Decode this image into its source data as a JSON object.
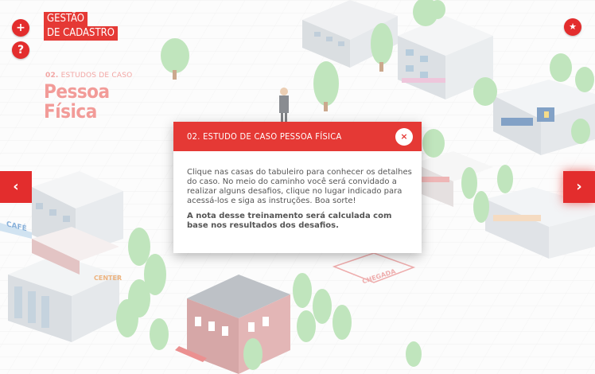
{
  "brand": {
    "line1": "GESTÃO",
    "line2": "DE CADASTRO"
  },
  "buttons": {
    "plus": "+",
    "help": "?",
    "star": "★",
    "prev": "‹",
    "next": "›"
  },
  "section": {
    "number": "02.",
    "label": "ESTUDOS DE CASO",
    "title1": "Pessoa",
    "title2": "Física"
  },
  "modal": {
    "title": "02. ESTUDO DE CASO PESSOA FÍSICA",
    "close": "×",
    "paragraph1": "Clique nas casas do tabuleiro para conhecer os detalhes do caso. No meio do caminho você será convidado a realizar alguns desafios, clique no lugar indicado para acessá-los e siga as instruções. Boa sorte!",
    "paragraph2": "A nota desse treinamento será calculada com base nos resultados dos desafios."
  },
  "board": {
    "store_sign": "CAFÉ",
    "center_sign": "CENTER",
    "finish_label": "CHEGADA"
  },
  "colors": {
    "accent": "#e53935",
    "title_faded": "#f29b98"
  }
}
